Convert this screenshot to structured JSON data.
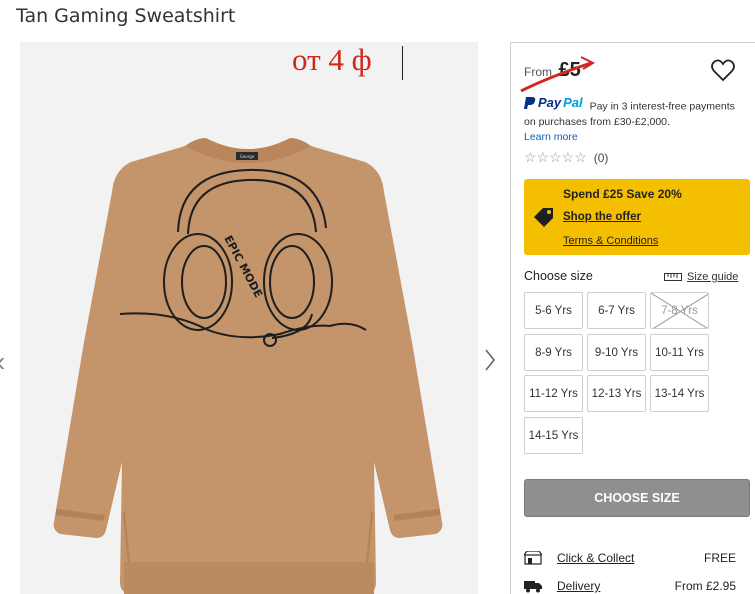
{
  "product": {
    "title": "Tan Gaming Sweatshirt",
    "annotation": "от 4 ф",
    "image_alt": "Tan gaming sweatshirt with headphones print",
    "print_text": "EPIC MODE",
    "label_text": "George"
  },
  "price": {
    "from_label": "From",
    "value": "£5"
  },
  "paypal": {
    "brand_pay": "Pay",
    "brand_pal": "Pal",
    "message": "Pay in 3 interest-free payments on purchases from £30-£2,000.",
    "learn_more": "Learn more"
  },
  "rating": {
    "stars_filled": 0,
    "stars_total": 5,
    "count": "(0)"
  },
  "promo": {
    "headline": "Spend £25 Save 20%",
    "link": "Shop the offer",
    "terms": "Terms & Conditions"
  },
  "sizes": {
    "label": "Choose size",
    "guide": "Size guide",
    "options": [
      {
        "label": "5-6 Yrs",
        "available": true
      },
      {
        "label": "6-7 Yrs",
        "available": true
      },
      {
        "label": "7-8 Yrs",
        "available": false
      },
      {
        "label": "8-9 Yrs",
        "available": true
      },
      {
        "label": "9-10 Yrs",
        "available": true
      },
      {
        "label": "10-11 Yrs",
        "available": true
      },
      {
        "label": "11-12 Yrs",
        "available": true
      },
      {
        "label": "12-13 Yrs",
        "available": true
      },
      {
        "label": "13-14 Yrs",
        "available": true
      },
      {
        "label": "14-15 Yrs",
        "available": true
      }
    ]
  },
  "cta": {
    "label": "CHOOSE SIZE"
  },
  "delivery": [
    {
      "label": "Click & Collect",
      "price": "FREE",
      "icon": "store-icon"
    },
    {
      "label": "Delivery",
      "price": "From £2.95",
      "icon": "truck-icon"
    }
  ],
  "colors": {
    "annotation_red": "#d0281f",
    "promo_yellow": "#f4bf00",
    "button_grey": "#8f8f8f",
    "sweatshirt_tan": "#c4946a",
    "link_blue": "#0b5fb3"
  }
}
